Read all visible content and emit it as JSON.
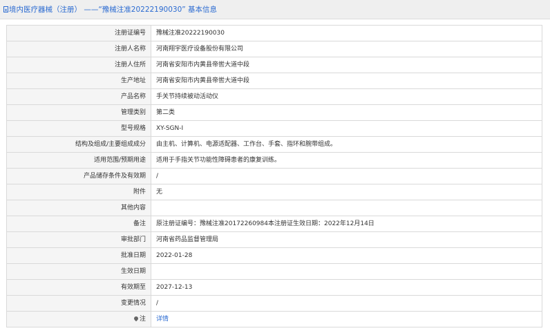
{
  "header": {
    "title": "境内医疗器械（注册） ——“豫械注准20222190030” 基本信息",
    "icon": "document-icon",
    "color": "#2a6ad1"
  },
  "rows": [
    {
      "label": "注册证编号",
      "value": "豫械注准20222190030"
    },
    {
      "label": "注册人名称",
      "value": "河南翔宇医疗设备股份有限公司"
    },
    {
      "label": "注册人住所",
      "value": "河南省安阳市内黄县帝喾大道中段"
    },
    {
      "label": "生产地址",
      "value": "河南省安阳市内黄县帝喾大道中段"
    },
    {
      "label": "产品名称",
      "value": "手关节持续被动活动仪"
    },
    {
      "label": "管理类别",
      "value": "第二类"
    },
    {
      "label": "型号规格",
      "value": "XY-SGN-Ⅰ"
    },
    {
      "label": "结构及组成/主要组成成分",
      "value": "由主机、计算机、电源适配器、工作台、手套、指环和腕带组成。"
    },
    {
      "label": "适用范围/预期用途",
      "value": "适用于手指关节功能性障碍患者的康复训练。"
    },
    {
      "label": "产品储存条件及有效期",
      "value": "/"
    },
    {
      "label": "附件",
      "value": "无"
    },
    {
      "label": "其他内容",
      "value": ""
    },
    {
      "label": "备注",
      "value": "原注册证编号：豫械注准20172260984本注册证生效日期：2022年12月14日"
    },
    {
      "label": "审批部门",
      "value": "河南省药品监督管理局"
    },
    {
      "label": "批准日期",
      "value": "2022-01-28"
    },
    {
      "label": "生效日期",
      "value": ""
    },
    {
      "label": "有效期至",
      "value": "2027-12-13"
    },
    {
      "label": "变更情况",
      "value": "/"
    }
  ],
  "note_row": {
    "label": "注",
    "icon": "pin-icon",
    "link": "详情"
  }
}
